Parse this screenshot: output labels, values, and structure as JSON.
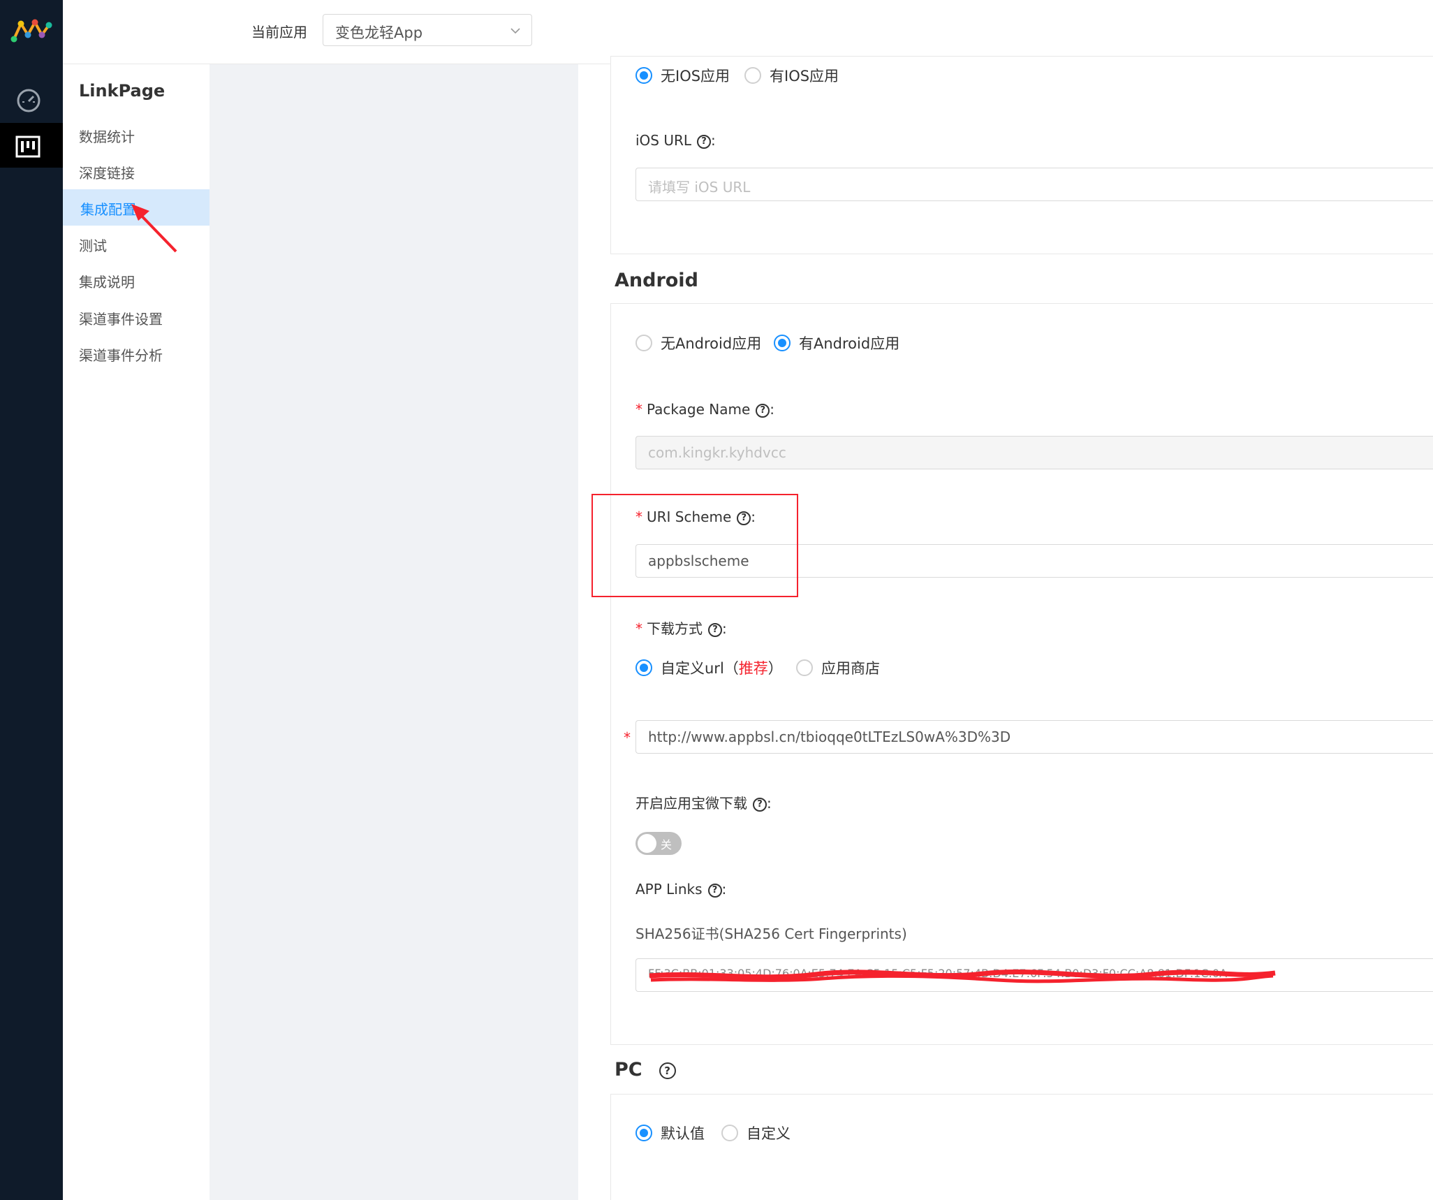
{
  "header": {
    "app_label": "当前应用",
    "app_select_value": "变色龙轻App"
  },
  "sidebar": {
    "title": "LinkPage",
    "items": [
      {
        "label": "数据统计"
      },
      {
        "label": "深度链接"
      },
      {
        "label": "集成配置"
      },
      {
        "label": "测试"
      },
      {
        "label": "集成说明"
      },
      {
        "label": "渠道事件设置"
      },
      {
        "label": "渠道事件分析"
      }
    ]
  },
  "ios": {
    "radio_none": "无IOS应用",
    "radio_has": "有IOS应用",
    "url_label": "iOS URL",
    "url_placeholder": "请填写 iOS URL"
  },
  "android": {
    "title": "Android",
    "radio_none": "无Android应用",
    "radio_has": "有Android应用",
    "package_label": "Package Name",
    "package_value": "com.kingkr.kyhdvcc",
    "scheme_label": "URI Scheme",
    "scheme_value": "appbslscheme",
    "download_label": "下载方式",
    "download_custom": "自定义url",
    "download_recommend": "推荐",
    "download_store": "应用商店",
    "download_url": "http://www.appbsl.cn/tbioqqe0tLTEzLS0wA%3D%3D",
    "yyb_label": "开启应用宝微下载",
    "toggle_text": "关",
    "applinks_label": "APP Links",
    "sha_label": "SHA256证书(SHA256 Cert Fingerprints)",
    "sha_value": "FF:3C:BB:01:33:05:4D:76:0A:E5:74:EA:C5:15:C5:F5:20:57:4B:D4:E7:6F:54:B0:D3:F0:CC:A8:81:DF:1C:0A"
  },
  "pc": {
    "title": "PC",
    "radio_default": "默认值",
    "radio_custom": "自定义"
  },
  "colors": {
    "accent": "#1890ff",
    "required": "#f5222d",
    "nav_dark": "#0f1b2a"
  }
}
